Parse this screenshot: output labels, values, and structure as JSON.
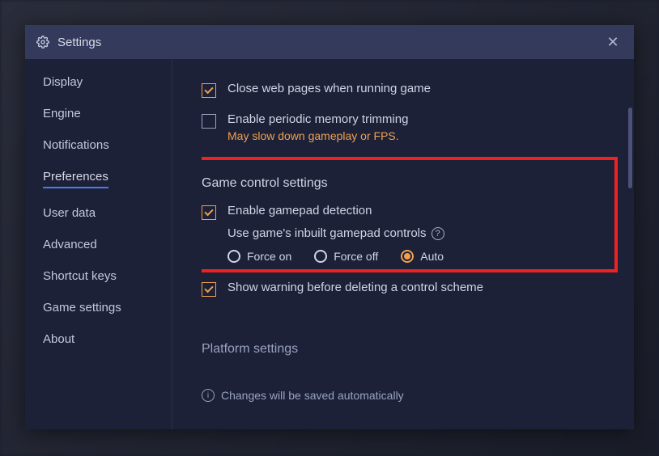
{
  "modal": {
    "title": "Settings"
  },
  "sidebar": {
    "items": [
      {
        "label": "Display"
      },
      {
        "label": "Engine"
      },
      {
        "label": "Notifications"
      },
      {
        "label": "Preferences"
      },
      {
        "label": "User data"
      },
      {
        "label": "Advanced"
      },
      {
        "label": "Shortcut keys"
      },
      {
        "label": "Game settings"
      },
      {
        "label": "About"
      }
    ],
    "active_index": 3
  },
  "options": {
    "close_web_pages": {
      "label": "Close web pages when running game",
      "checked": true
    },
    "memory_trimming": {
      "label": "Enable periodic memory trimming",
      "checked": false,
      "warning": "May slow down gameplay or FPS."
    },
    "section_game_control": "Game control settings",
    "gamepad_detection": {
      "label": "Enable gamepad detection",
      "checked": true
    },
    "inbuilt_gamepad": {
      "label": "Use game's inbuilt gamepad controls",
      "choices": [
        "Force on",
        "Force off",
        "Auto"
      ],
      "selected": "Auto"
    },
    "show_warning_delete": {
      "label": "Show warning before deleting a control scheme",
      "checked": true
    },
    "section_platform": "Platform settings",
    "auto_save_note": "Changes will be saved automatically"
  }
}
